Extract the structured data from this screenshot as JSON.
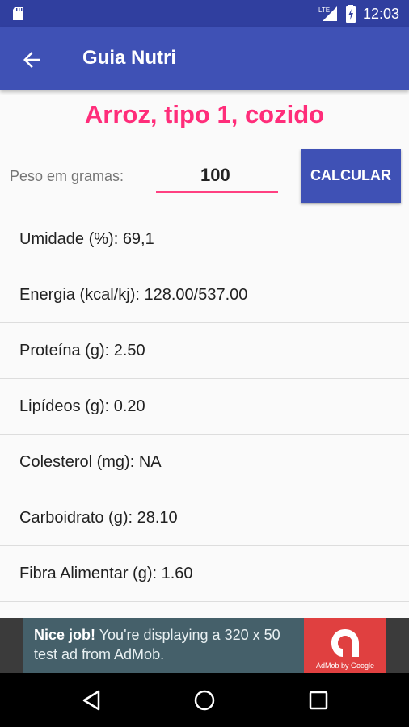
{
  "statusbar": {
    "time": "12:03",
    "network": "LTE",
    "icons": [
      "sd-card-icon",
      "signal-icon",
      "battery-charging-icon"
    ]
  },
  "appbar": {
    "title": "Guia Nutri",
    "back_icon": "arrow-back-icon"
  },
  "food": {
    "name": "Arroz, tipo 1, cozido"
  },
  "weight": {
    "label": "Peso em gramas:",
    "value": "100"
  },
  "calculate_button": "CALCULAR",
  "nutrients": [
    "Umidade (%): 69,1",
    "Energia (kcal/kj): 128.00/537.00",
    "Proteína (g): 2.50",
    "Lipídeos (g): 0.20",
    "Colesterol (mg): NA",
    "Carboidrato (g): 28.10",
    "Fibra Alimentar (g): 1.60"
  ],
  "ad": {
    "headline": "Nice job!",
    "body": " You're displaying a 320 x 50 test ad from AdMob.",
    "badge": "AdMob by Google"
  },
  "navbar": {
    "icons": [
      "nav-back-icon",
      "nav-home-icon",
      "nav-recents-icon"
    ]
  },
  "colors": {
    "primary": "#3f51b5",
    "primary_dark": "#303f9f",
    "accent": "#ff4081",
    "title_pink": "#ff2d7a"
  }
}
